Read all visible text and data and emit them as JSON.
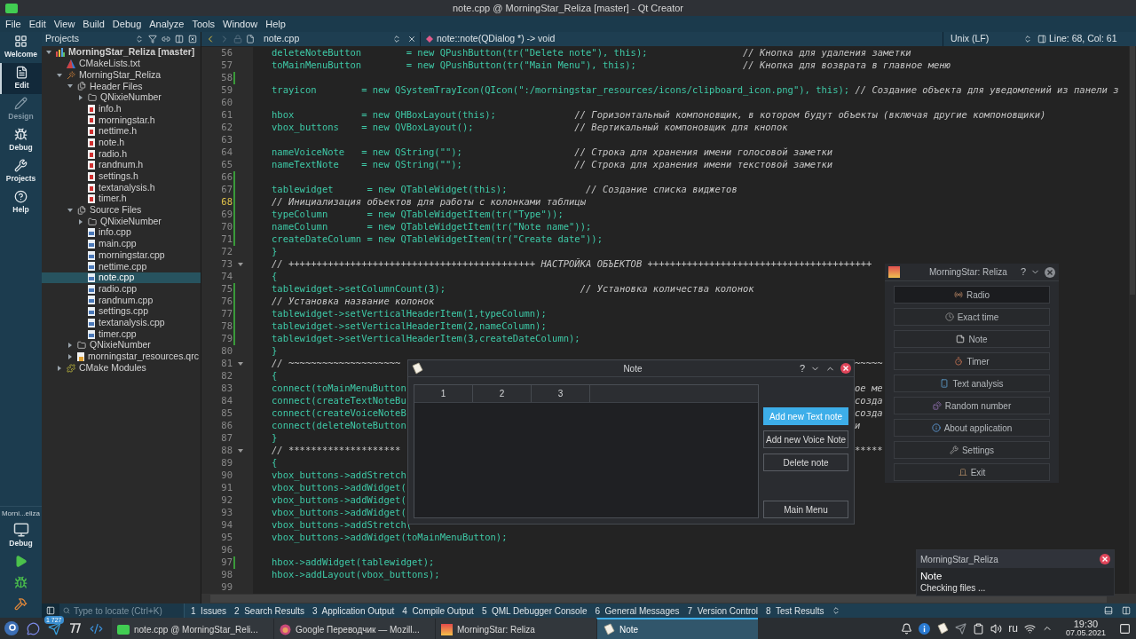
{
  "window": {
    "title": "note.cpp @ MorningStar_Reliza [master] - Qt Creator"
  },
  "menu": [
    "File",
    "Edit",
    "View",
    "Build",
    "Debug",
    "Analyze",
    "Tools",
    "Window",
    "Help"
  ],
  "modes": [
    {
      "label": "Welcome",
      "selected": false,
      "disabled": false
    },
    {
      "label": "Edit",
      "selected": true,
      "disabled": false
    },
    {
      "label": "Design",
      "selected": false,
      "disabled": true
    },
    {
      "label": "Debug",
      "selected": false,
      "disabled": false
    },
    {
      "label": "Projects",
      "selected": false,
      "disabled": false
    },
    {
      "label": "Help",
      "selected": false,
      "disabled": false
    }
  ],
  "kit": {
    "target": "Morni...eliza",
    "mode": "Debug"
  },
  "projects": {
    "title": "Projects",
    "tree": [
      {
        "label": "MorningStar_Reliza [master]",
        "kind": "project",
        "expanded": true,
        "selected": false,
        "children": [
          {
            "label": "CMakeLists.txt",
            "kind": "cmake",
            "selected": false
          },
          {
            "label": "MorningStar_Reliza",
            "kind": "target",
            "expanded": true,
            "selected": false,
            "children": [
              {
                "label": "Header Files",
                "kind": "group",
                "expanded": true,
                "selected": false,
                "children": [
                  {
                    "label": "QNixieNumber",
                    "kind": "folder",
                    "expanded": false,
                    "selected": false
                  },
                  {
                    "label": "info.h",
                    "kind": "header",
                    "selected": false
                  },
                  {
                    "label": "morningstar.h",
                    "kind": "header",
                    "selected": false
                  },
                  {
                    "label": "nettime.h",
                    "kind": "header",
                    "selected": false
                  },
                  {
                    "label": "note.h",
                    "kind": "header",
                    "selected": false
                  },
                  {
                    "label": "radio.h",
                    "kind": "header",
                    "selected": false
                  },
                  {
                    "label": "randnum.h",
                    "kind": "header",
                    "selected": false
                  },
                  {
                    "label": "settings.h",
                    "kind": "header",
                    "selected": false
                  },
                  {
                    "label": "textanalysis.h",
                    "kind": "header",
                    "selected": false
                  },
                  {
                    "label": "timer.h",
                    "kind": "header",
                    "selected": false
                  }
                ]
              },
              {
                "label": "Source Files",
                "kind": "group",
                "expanded": true,
                "selected": false,
                "children": [
                  {
                    "label": "QNixieNumber",
                    "kind": "folder",
                    "expanded": false,
                    "selected": false
                  },
                  {
                    "label": "info.cpp",
                    "kind": "source",
                    "selected": false
                  },
                  {
                    "label": "main.cpp",
                    "kind": "source",
                    "selected": false
                  },
                  {
                    "label": "morningstar.cpp",
                    "kind": "source",
                    "selected": false
                  },
                  {
                    "label": "nettime.cpp",
                    "kind": "source",
                    "selected": false
                  },
                  {
                    "label": "note.cpp",
                    "kind": "source",
                    "selected": true
                  },
                  {
                    "label": "radio.cpp",
                    "kind": "source",
                    "selected": false
                  },
                  {
                    "label": "randnum.cpp",
                    "kind": "source",
                    "selected": false
                  },
                  {
                    "label": "settings.cpp",
                    "kind": "source",
                    "selected": false
                  },
                  {
                    "label": "textanalysis.cpp",
                    "kind": "source",
                    "selected": false
                  },
                  {
                    "label": "timer.cpp",
                    "kind": "source",
                    "selected": false
                  }
                ]
              },
              {
                "label": "QNixieNumber",
                "kind": "folder",
                "expanded": false,
                "selected": false
              },
              {
                "label": "morningstar_resources.qrc",
                "kind": "resource",
                "expanded": false,
                "selected": false
              }
            ]
          },
          {
            "label": "CMake Modules",
            "kind": "modules",
            "expanded": false,
            "selected": false
          }
        ]
      }
    ]
  },
  "editor": {
    "file": "note.cpp",
    "symbol": "note::note(QDialog *) -> void",
    "line_ending": "Unix (LF)",
    "position": "Line: 68, Col: 61",
    "lines": [
      {
        "n": "56",
        "changed": false,
        "current": false,
        "fold": false,
        "code": "deleteNoteButton        = new QPushButton(tr(\"Delete note\"), this);",
        "comment": "                 // Кнопка для удаления заметки"
      },
      {
        "n": "57",
        "changed": false,
        "current": false,
        "fold": false,
        "code": "toMainMenuButton        = new QPushButton(tr(\"Main Menu\"), this);",
        "comment": "                   // Кнопка для возврата в главное меню"
      },
      {
        "n": "58",
        "changed": true,
        "current": false,
        "fold": false
      },
      {
        "n": "59",
        "changed": false,
        "current": false,
        "fold": false,
        "code": "trayicon        = new QSystemTrayIcon(QIcon(\":/morningstar_resources/icons/clipboard_icon.png\"), this);",
        "comment": " // Создание объекта для уведомлений из панели з"
      },
      {
        "n": "60",
        "changed": false,
        "current": false,
        "fold": false
      },
      {
        "n": "61",
        "changed": false,
        "current": false,
        "fold": false,
        "code": "hbox            = new QHBoxLayout(this);",
        "comment": "              // Горизонтальный компоновщик, в котором будут объекты (включая другие компоновщики)"
      },
      {
        "n": "62",
        "changed": false,
        "current": false,
        "fold": false,
        "code": "vbox_buttons    = new QVBoxLayout();",
        "comment": "                  // Вертикальный компоновщик для кнопок"
      },
      {
        "n": "63",
        "changed": false,
        "current": false,
        "fold": false
      },
      {
        "n": "64",
        "changed": false,
        "current": false,
        "fold": false,
        "code": "nameVoiceNote   = new QString(\"\");",
        "comment": "                    // Строка для хранения имени голосовой заметки"
      },
      {
        "n": "65",
        "changed": false,
        "current": false,
        "fold": false,
        "code": "nameTextNote    = new QString(\"\");",
        "comment": "                    // Строка для хранения имени текстовой заметки"
      },
      {
        "n": "66",
        "changed": true,
        "current": false,
        "fold": false
      },
      {
        "n": "67",
        "changed": true,
        "current": false,
        "fold": false,
        "code": "tablewidget      = new QTableWidget(this);",
        "comment": "              // Создание списка виджетов"
      },
      {
        "n": "68",
        "changed": true,
        "current": true,
        "fold": false,
        "comment": "// Инициализация объектов для работы с колонками таблицы"
      },
      {
        "n": "69",
        "changed": true,
        "current": false,
        "fold": false,
        "code": "typeColumn       = new QTableWidgetItem(tr(\"Type\"));"
      },
      {
        "n": "70",
        "changed": true,
        "current": false,
        "fold": false,
        "code": "nameColumn       = new QTableWidgetItem(tr(\"Note name\"));"
      },
      {
        "n": "71",
        "changed": true,
        "current": false,
        "fold": false,
        "code": "createDateColumn = new QTableWidgetItem(tr(\"Create date\"));"
      },
      {
        "n": "72",
        "changed": false,
        "current": false,
        "fold": false,
        "code": "}"
      },
      {
        "n": "73",
        "changed": false,
        "current": false,
        "fold": true,
        "comment": "// ++++++++++++++++++++++++++++++++++++++++++++ НАСТРОЙКА ОБЪЕКТОВ ++++++++++++++++++++++++++++++++++++++++"
      },
      {
        "n": "74",
        "changed": false,
        "current": false,
        "fold": false,
        "code": "{"
      },
      {
        "n": "75",
        "changed": true,
        "current": false,
        "fold": false,
        "code": "tablewidget->setColumnCount(3);",
        "comment": "                        // Установка количества колонок"
      },
      {
        "n": "76",
        "changed": true,
        "current": false,
        "fold": false,
        "comment": "// Установка название колонок"
      },
      {
        "n": "77",
        "changed": true,
        "current": false,
        "fold": false,
        "code": "tablewidget->setVerticalHeaderItem(1,typeColumn);"
      },
      {
        "n": "78",
        "changed": true,
        "current": false,
        "fold": false,
        "code": "tablewidget->setVerticalHeaderItem(2,nameColumn);"
      },
      {
        "n": "79",
        "changed": true,
        "current": false,
        "fold": false,
        "code": "tablewidget->setVerticalHeaderItem(3,createDateColumn);"
      },
      {
        "n": "80",
        "changed": false,
        "current": false,
        "fold": false,
        "code": "}"
      },
      {
        "n": "81",
        "changed": false,
        "current": false,
        "fold": true,
        "comment": "// ~~~~~~~~~~~~~~~~~~~~",
        "tail": "~~~~~"
      },
      {
        "n": "82",
        "changed": false,
        "current": false,
        "fold": false,
        "code": "{"
      },
      {
        "n": "83",
        "changed": false,
        "current": false,
        "fold": false,
        "code": "connect(toMainMenuButton",
        "tail": "ое ме"
      },
      {
        "n": "84",
        "changed": false,
        "current": false,
        "fold": false,
        "code": "connect(createTextNoteBu",
        "tail": "созда"
      },
      {
        "n": "85",
        "changed": false,
        "current": false,
        "fold": false,
        "code": "connect(createVoiceNoteB",
        "tail": "созда"
      },
      {
        "n": "86",
        "changed": false,
        "current": false,
        "fold": false,
        "code": "connect(deleteNoteButton",
        "tail": "и"
      },
      {
        "n": "87",
        "changed": false,
        "current": false,
        "fold": false,
        "code": "}"
      },
      {
        "n": "88",
        "changed": false,
        "current": false,
        "fold": true,
        "comment": "// ********************",
        "tail": "*****"
      },
      {
        "n": "89",
        "changed": false,
        "current": false,
        "fold": false,
        "code": "{"
      },
      {
        "n": "90",
        "changed": false,
        "current": false,
        "fold": false,
        "code": "vbox_buttons->addStretch"
      },
      {
        "n": "91",
        "changed": false,
        "current": false,
        "fold": false,
        "code": "vbox_buttons->addWidget("
      },
      {
        "n": "92",
        "changed": false,
        "current": false,
        "fold": false,
        "code": "vbox_buttons->addWidget("
      },
      {
        "n": "93",
        "changed": false,
        "current": false,
        "fold": false,
        "code": "vbox_buttons->addWidget("
      },
      {
        "n": "94",
        "changed": false,
        "current": false,
        "fold": false,
        "code": "vbox_buttons->addStretch("
      },
      {
        "n": "95",
        "changed": false,
        "current": false,
        "fold": false,
        "code": "vbox_buttons->addWidget(toMainMenuButton);"
      },
      {
        "n": "96",
        "changed": false,
        "current": false,
        "fold": false
      },
      {
        "n": "97",
        "changed": true,
        "current": false,
        "fold": false,
        "code": "hbox->addWidget(tablewidget);"
      },
      {
        "n": "98",
        "changed": false,
        "current": false,
        "fold": false,
        "code": "hbox->addLayout(vbox_buttons);"
      },
      {
        "n": "99",
        "changed": false,
        "current": false,
        "fold": false
      }
    ]
  },
  "note_dialog": {
    "title": "Note",
    "help": "?",
    "columns": [
      "1",
      "2",
      "3"
    ],
    "buttons": [
      {
        "label": "Add new Text note",
        "focused": true
      },
      {
        "label": "Add new Voice Note",
        "focused": false
      },
      {
        "label": "Delete note",
        "focused": false
      },
      {
        "label": "Main Menu",
        "focused": false
      }
    ]
  },
  "main_window": {
    "title": "MorningStar: Reliza",
    "help": "?",
    "buttons": [
      {
        "label": "Radio",
        "hovered": true
      },
      {
        "label": "Exact time",
        "hovered": false
      },
      {
        "label": "Note",
        "hovered": false
      },
      {
        "label": "Timer",
        "hovered": false
      },
      {
        "label": "Text analysis",
        "hovered": false
      },
      {
        "label": "Random number",
        "hovered": false
      },
      {
        "label": "About application",
        "hovered": false
      },
      {
        "label": "Settings",
        "hovered": false
      },
      {
        "label": "Exit",
        "hovered": false
      }
    ]
  },
  "notification": {
    "app": "MorningStar_Reliza",
    "title": "Note",
    "text": "Checking files ..."
  },
  "output_bar": {
    "placeholder": "Type to locate (Ctrl+K)",
    "tabs": [
      {
        "number": "1",
        "label": "Issues"
      },
      {
        "number": "2",
        "label": "Search Results"
      },
      {
        "number": "3",
        "label": "Application Output"
      },
      {
        "number": "4",
        "label": "Compile Output"
      },
      {
        "number": "5",
        "label": "QML Debugger Console"
      },
      {
        "number": "6",
        "label": "General Messages"
      },
      {
        "number": "7",
        "label": "Version Control"
      },
      {
        "number": "8",
        "label": "Test Results"
      }
    ]
  },
  "taskbar": {
    "badge": "1 727",
    "tasks": [
      {
        "label": "note.cpp @ MorningStar_Reli...",
        "selected": false
      },
      {
        "label": "Google Переводчик — Mozill...",
        "selected": false
      },
      {
        "label": "MorningStar: Reliza",
        "selected": false
      },
      {
        "label": "Note",
        "selected": true
      }
    ],
    "language": "ru",
    "time": "19:30",
    "date": "07.05.2021"
  }
}
